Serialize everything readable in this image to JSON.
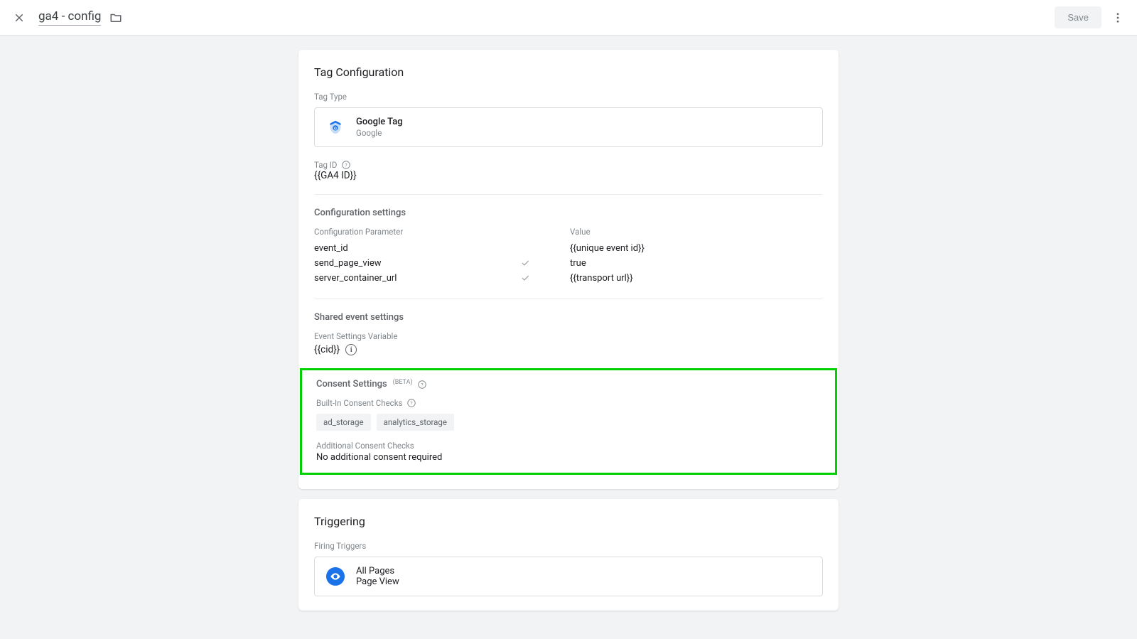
{
  "header": {
    "title": "ga4 - config",
    "save_label": "Save"
  },
  "tag_config": {
    "title": "Tag Configuration",
    "tag_type_label": "Tag Type",
    "tag_type_name": "Google Tag",
    "tag_type_vendor": "Google",
    "tag_id_label": "Tag ID",
    "tag_id_value": "{{GA4 ID}}",
    "config_section": "Configuration settings",
    "param_header_param": "Configuration Parameter",
    "param_header_value": "Value",
    "params": [
      {
        "name": "event_id",
        "check": false,
        "value": "{{unique event id}}"
      },
      {
        "name": "send_page_view",
        "check": true,
        "value": "true"
      },
      {
        "name": "server_container_url",
        "check": true,
        "value": "{{transport url}}"
      }
    ],
    "shared_section": "Shared event settings",
    "event_settings_var_label": "Event Settings Variable",
    "event_settings_var_value": "{{cid}}",
    "consent": {
      "title": "Consent Settings",
      "beta": "(BETA)",
      "builtin_label": "Built-In Consent Checks",
      "chips": [
        "ad_storage",
        "analytics_storage"
      ],
      "additional_label": "Additional Consent Checks",
      "additional_value": "No additional consent required"
    }
  },
  "triggering": {
    "title": "Triggering",
    "firing_label": "Firing Triggers",
    "trigger_name": "All Pages",
    "trigger_type": "Page View"
  }
}
